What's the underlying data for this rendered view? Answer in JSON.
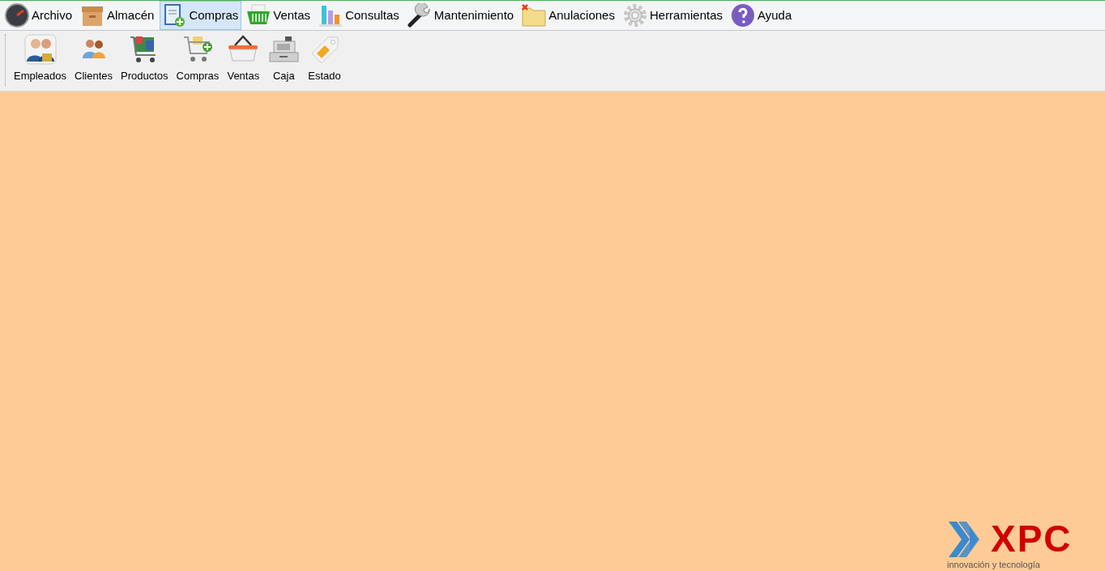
{
  "menu_bar": [
    {
      "label": "Archivo",
      "kind": "gauge",
      "selected": false
    },
    {
      "label": "Almacén",
      "kind": "box",
      "selected": false
    },
    {
      "label": "Compras",
      "kind": "notebook",
      "selected": true
    },
    {
      "label": "Ventas",
      "kind": "basket",
      "selected": false
    },
    {
      "label": "Consultas",
      "kind": "chart",
      "selected": false
    },
    {
      "label": "Mantenimiento",
      "kind": "wrench",
      "selected": false
    },
    {
      "label": "Anulaciones",
      "kind": "folder",
      "selected": false
    },
    {
      "label": "Herramientas",
      "kind": "gear",
      "selected": false
    },
    {
      "label": "Ayuda",
      "kind": "help",
      "selected": false
    }
  ],
  "toolbar": [
    {
      "label": "Empleados",
      "kind": "users-lock"
    },
    {
      "label": "Clientes",
      "kind": "users"
    },
    {
      "label": "Productos",
      "kind": "cart-full"
    },
    {
      "label": "Compras",
      "kind": "cart-add"
    },
    {
      "label": "Ventas",
      "kind": "basket"
    },
    {
      "label": "Caja",
      "kind": "register"
    },
    {
      "label": "Estado",
      "kind": "tag"
    }
  ],
  "logo": {
    "name": "XPC",
    "tagline": "innovación y tecnología"
  }
}
